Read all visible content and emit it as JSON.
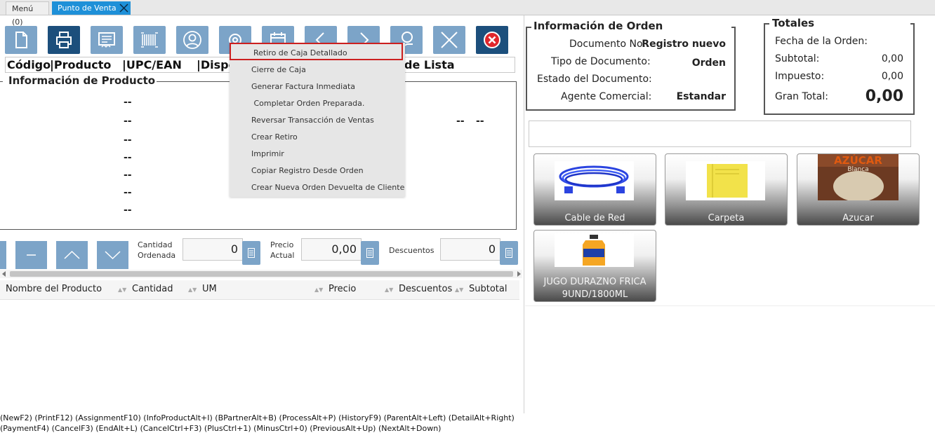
{
  "tabs": {
    "menu": "Menú (0)",
    "active": "Punto de Venta"
  },
  "toolbar": {
    "buttons": [
      "new-icon",
      "print-icon",
      "invoice-icon",
      "barcode-icon",
      "partner-icon",
      "process-icon",
      "calendar-icon",
      "previous-icon",
      "next-icon",
      "cash-icon",
      "cancel-icon",
      "exit-icon"
    ]
  },
  "search_header": {
    "columns": [
      "Código",
      "|Producto",
      "|UPC/EAN",
      "|Dispo",
      "de Lista"
    ]
  },
  "product_info": {
    "legend": "Información de Producto",
    "placeholder": "--"
  },
  "context_menu": {
    "items": [
      "Retiro de Caja Detallado",
      "Cierre de Caja",
      "Generar Factura Inmediata",
      " Completar Orden Preparada.",
      "Reversar Transacción de Ventas",
      "Crear Retiro",
      "Imprimir",
      "Copiar Registro Desde Orden",
      "Crear Nueva Orden Devuelta de Cliente"
    ],
    "selected": "Retiro de Caja Detallado"
  },
  "quantity_panel": {
    "cantidad_label_1": "Cantidad",
    "cantidad_label_2": "Ordenada",
    "cantidad_value": "0",
    "precio_label_1": "Precio",
    "precio_label_2": "Actual",
    "precio_value": "0,00",
    "descuentos_label": "Descuentos",
    "descuentos_value": "0"
  },
  "grid": {
    "columns": [
      "Nombre del Producto",
      "Cantidad",
      "UM",
      "Precio",
      "Descuentos",
      "Subtotal"
    ]
  },
  "order_info": {
    "legend": "Información de Orden",
    "doc_no_label": "Documento No.:",
    "doc_no_value": "Registro nuevo",
    "doc_type_label": "Tipo de Documento:",
    "doc_type_value": "Orden",
    "doc_status_label": "Estado del Documento:",
    "doc_status_value": "",
    "agent_label": "Agente Comercial:",
    "agent_value": "Estandar"
  },
  "totals": {
    "legend": "Totales",
    "date_label": "Fecha de la Orden:",
    "date_value": "",
    "subtotal_label": "Subtotal:",
    "subtotal_value": "0,00",
    "tax_label": "Impuesto:",
    "tax_value": "0,00",
    "grand_label": "Gran Total:",
    "grand_value": "0,00"
  },
  "products": [
    {
      "name": "Cable de Red"
    },
    {
      "name": "Carpeta"
    },
    {
      "name": "Azucar",
      "image_text_1": "AZÚCAR",
      "image_text_2": "Blanca"
    },
    {
      "name_line_1": "JUGO DURAZNO FRICA",
      "name_line_2": "9UND/1800ML"
    }
  ],
  "footer": {
    "line1": "(NewF2) (PrintF12) (AssignmentF10) (InfoProductAlt+I) (BPartnerAlt+B) (ProcessAlt+P) (HistoryF9) (ParentAlt+Left) (DetailAlt+Right)",
    "line2": "(PaymentF4) (CancelF3) (EndAlt+L) (CancelCtrl+F3) (PlusCtrl+1) (MinusCtrl+0) (PreviousAlt+Up) (NextAlt+Down)"
  },
  "colors": {
    "tab_active": "#1e90d8",
    "toolbar_light": "#7ca4c8",
    "toolbar_dark": "#1c4f7c",
    "selection_border": "#cc1f1f"
  }
}
